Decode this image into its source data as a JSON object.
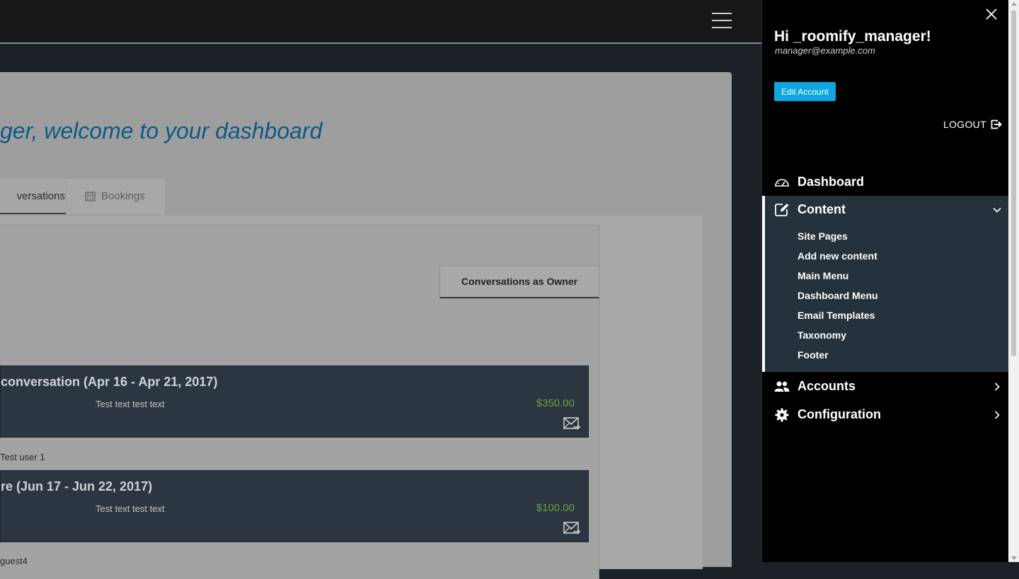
{
  "main": {
    "welcome": "ger, welcome to your dashboard",
    "tabs": [
      {
        "label": "versations"
      },
      {
        "label": "Bookings",
        "icon": "calendar-icon"
      }
    ],
    "subtab_label": "Conversations as Owner",
    "conversations": [
      {
        "title": "conversation (Apr 16 - Apr 21, 2017)",
        "desc": "Test text test text",
        "price": "$350.00",
        "user": "Test user 1"
      },
      {
        "title": "re (Jun 17 - Jun 22, 2017)",
        "desc": "Test text test text",
        "price": "$100.00",
        "user": "guest4"
      }
    ]
  },
  "drawer": {
    "greeting": "Hi _roomify_manager!",
    "email": "manager@example.com",
    "edit_button": "Edit Account",
    "logout": "LOGOUT",
    "nav": [
      {
        "label": "Dashboard",
        "icon": "dashboard-gauge-icon"
      },
      {
        "label": "Content",
        "icon": "edit-icon",
        "expanded": true,
        "children": [
          "Site Pages",
          "Add new content",
          "Main Menu",
          "Dashboard Menu",
          "Email Templates",
          "Taxonomy",
          "Footer"
        ]
      },
      {
        "label": "Accounts",
        "icon": "users-icon"
      },
      {
        "label": "Configuration",
        "icon": "gear-icon"
      }
    ]
  },
  "colors": {
    "accent": "#0ea5e0",
    "price": "#6f9f40",
    "welcome": "#0b5a86",
    "card": "#2b3640"
  }
}
